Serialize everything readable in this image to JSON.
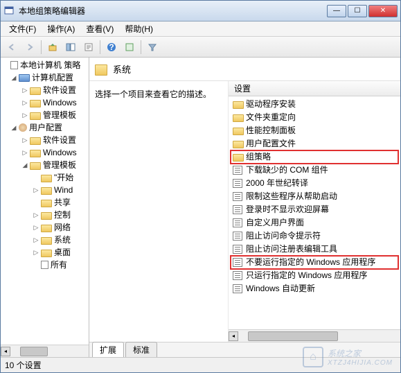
{
  "window": {
    "title": "本地组策略编辑器"
  },
  "menu": {
    "file": "文件(F)",
    "action": "操作(A)",
    "view": "查看(V)",
    "help": "帮助(H)"
  },
  "tree": {
    "root": "本地计算机 策略",
    "computer_config": "计算机配置",
    "cc_software": "软件设置",
    "cc_windows": "Windows",
    "cc_admin": "管理模板",
    "user_config": "用户配置",
    "uc_software": "软件设置",
    "uc_windows": "Windows",
    "uc_admin": "管理模板",
    "start_menu": "\"开始",
    "wind": "Wind",
    "share": "共享",
    "control": "控制",
    "network": "网络",
    "system": "系统",
    "desktop": "桌面",
    "all": "所有"
  },
  "header": {
    "title": "系统"
  },
  "description": "选择一个项目来查看它的描述。",
  "list_header": "设置",
  "items": {
    "driver_install": "驱动程序安装",
    "folder_redirect": "文件夹重定向",
    "perf_panel": "性能控制面板",
    "user_profile": "用户配置文件",
    "group_policy": "组策略",
    "download_com": "下载缺少的 COM 组件",
    "year_2000": "2000 年世纪转译",
    "restrict_help": "限制这些程序从帮助启动",
    "no_welcome": "登录时不显示欢迎屏幕",
    "custom_ui": "自定义用户界面",
    "block_cmd": "阻止访问命令提示符",
    "block_regedit": "阻止访问注册表编辑工具",
    "dont_run": "不要运行指定的 Windows 应用程序",
    "only_run": "只运行指定的 Windows 应用程序",
    "win_update": "Windows 自动更新"
  },
  "tabs": {
    "extended": "扩展",
    "standard": "标准"
  },
  "status": "10 个设置",
  "watermark": {
    "brand": "系统之家",
    "url": "XTZJ4HIJIA.COM"
  }
}
